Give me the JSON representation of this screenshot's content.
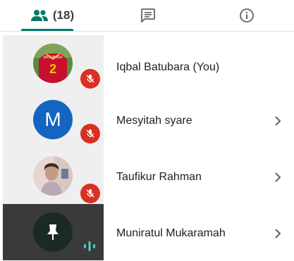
{
  "tabs": {
    "people": {
      "icon": "people-icon",
      "count": "(18)",
      "active": true
    },
    "chat": {
      "icon": "chat-icon"
    },
    "info": {
      "icon": "info-icon"
    }
  },
  "colors": {
    "accent": "#00796b",
    "muted_badge": "#d93025",
    "avatar_blue": "#1565c0",
    "tile_light": "#efefef",
    "tile_dark": "#3a3a3a"
  },
  "participants": [
    {
      "name": "Iqbal Batubara (You)",
      "avatar": "jersey-photo",
      "jersey_text": "BATUBARA",
      "jersey_number": "2",
      "muted": true,
      "has_chevron": false
    },
    {
      "name": "Mesyitah syare",
      "avatar_letter": "M",
      "muted": true,
      "has_chevron": true
    },
    {
      "name": "Taufikur Rahman",
      "avatar": "person-photo",
      "muted": true,
      "has_chevron": true
    },
    {
      "name": "Muniratul Mukaramah",
      "avatar": "pin-icon",
      "muted": false,
      "speaking": true,
      "has_chevron": true
    }
  ]
}
